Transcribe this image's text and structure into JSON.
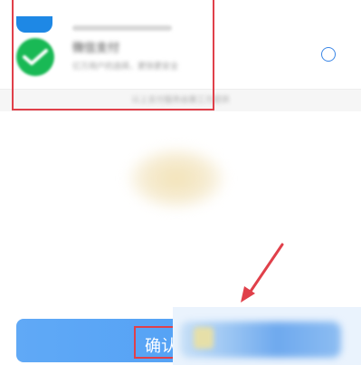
{
  "payment": {
    "wechat": {
      "title": "微信支付",
      "desc": "亿万用户的选择，更快更安全"
    },
    "notice": "以上支付服务由第三方提供"
  },
  "confirm": {
    "label": "确认"
  },
  "colors": {
    "wechat_green": "#19b955",
    "alipay_blue": "#1e88e5",
    "button_blue": "#4b9cf4",
    "highlight_red": "#e0404a",
    "radio_blue": "#3a86e6"
  },
  "icons": [
    "alipay-icon",
    "wechat-pay-icon",
    "radio-unselected-icon",
    "arrow-icon"
  ]
}
